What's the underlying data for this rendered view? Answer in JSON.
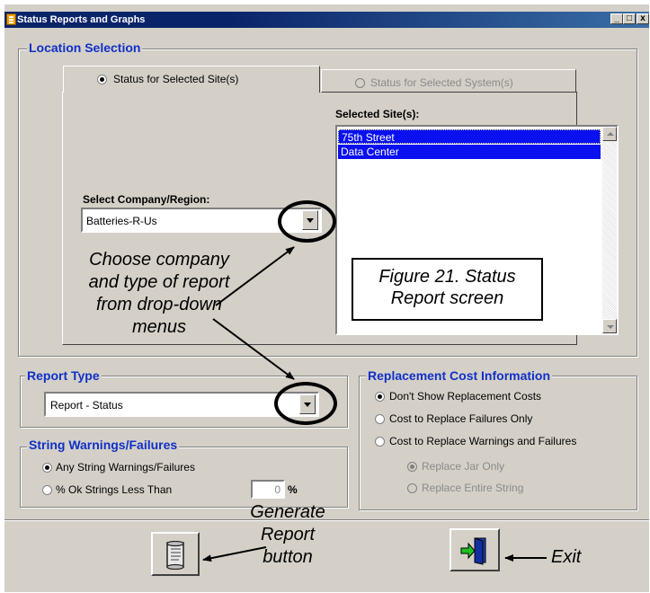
{
  "window": {
    "title": "Status Reports and Graphs",
    "minimize": "_",
    "maximize": "□",
    "close": "x"
  },
  "location": {
    "label": "Location Selection",
    "tab_site": "Status for Selected Site(s)",
    "tab_system": "Status for Selected System(s)",
    "selected_sites_label": "Selected Site(s):",
    "sites": [
      "75th Street",
      "Data Center"
    ],
    "company_label": "Select Company/Region:",
    "company_value": "Batteries-R-Us"
  },
  "report_type": {
    "label": "Report Type",
    "value": "Report - Status"
  },
  "string_warnings": {
    "label": "String Warnings/Failures",
    "opt_any": "Any String Warnings/Failures",
    "opt_ok": "% Ok Strings Less Than",
    "ok_value": "0",
    "pct": "%"
  },
  "replacement": {
    "label": "Replacement Cost Information",
    "opt_dont": "Don't Show Replacement Costs",
    "opt_fail": "Cost to Replace Failures Only",
    "opt_warn": "Cost to Replace Warnings and Failures",
    "sub_jar": "Replace Jar Only",
    "sub_string": "Replace Entire String"
  },
  "annotations": {
    "choose": [
      "Choose company",
      "and type of report",
      "from drop-down",
      "menus"
    ],
    "figure": [
      "Figure 21. Status",
      "Report screen"
    ],
    "generate": [
      "Generate",
      "Report",
      "button"
    ],
    "exit": "Exit"
  }
}
